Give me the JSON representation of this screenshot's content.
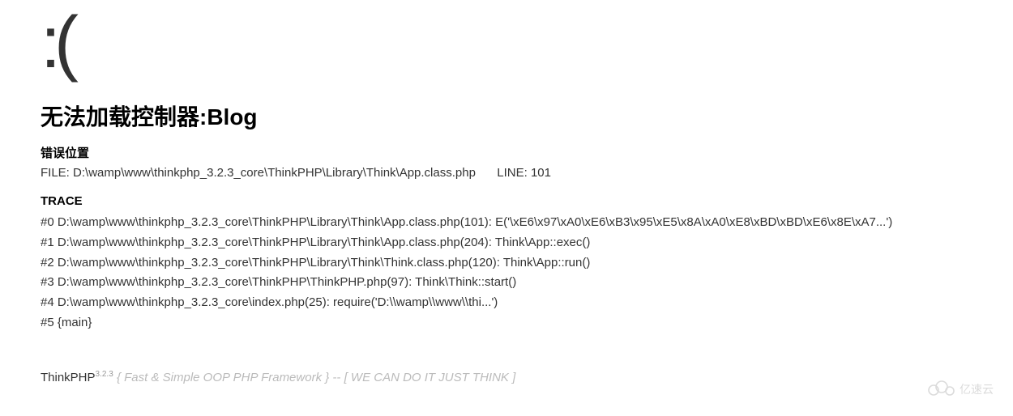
{
  "sad_face": ":(",
  "error_title": "无法加载控制器:Blog",
  "location": {
    "header": "错误位置",
    "file_label": "FILE:",
    "file_path": "D:\\wamp\\www\\thinkphp_3.2.3_core\\ThinkPHP\\Library\\Think\\App.class.php",
    "line_label": "LINE:",
    "line_number": "101"
  },
  "trace": {
    "header": "TRACE",
    "lines": [
      "#0 D:\\wamp\\www\\thinkphp_3.2.3_core\\ThinkPHP\\Library\\Think\\App.class.php(101): E('\\xE6\\x97\\xA0\\xE6\\xB3\\x95\\xE5\\x8A\\xA0\\xE8\\xBD\\xBD\\xE6\\x8E\\xA7...')",
      "#1 D:\\wamp\\www\\thinkphp_3.2.3_core\\ThinkPHP\\Library\\Think\\App.class.php(204): Think\\App::exec()",
      "#2 D:\\wamp\\www\\thinkphp_3.2.3_core\\ThinkPHP\\Library\\Think\\Think.class.php(120): Think\\App::run()",
      "#3 D:\\wamp\\www\\thinkphp_3.2.3_core\\ThinkPHP\\ThinkPHP.php(97): Think\\Think::start()",
      "#4 D:\\wamp\\www\\thinkphp_3.2.3_core\\index.php(25): require('D:\\\\wamp\\\\www\\\\thi...')",
      "#5 {main}"
    ]
  },
  "footer": {
    "brand": "ThinkPHP",
    "version": "3.2.3",
    "slogan": "{ Fast & Simple OOP PHP Framework } -- [ WE CAN DO IT JUST THINK ]"
  },
  "watermark": "亿速云"
}
